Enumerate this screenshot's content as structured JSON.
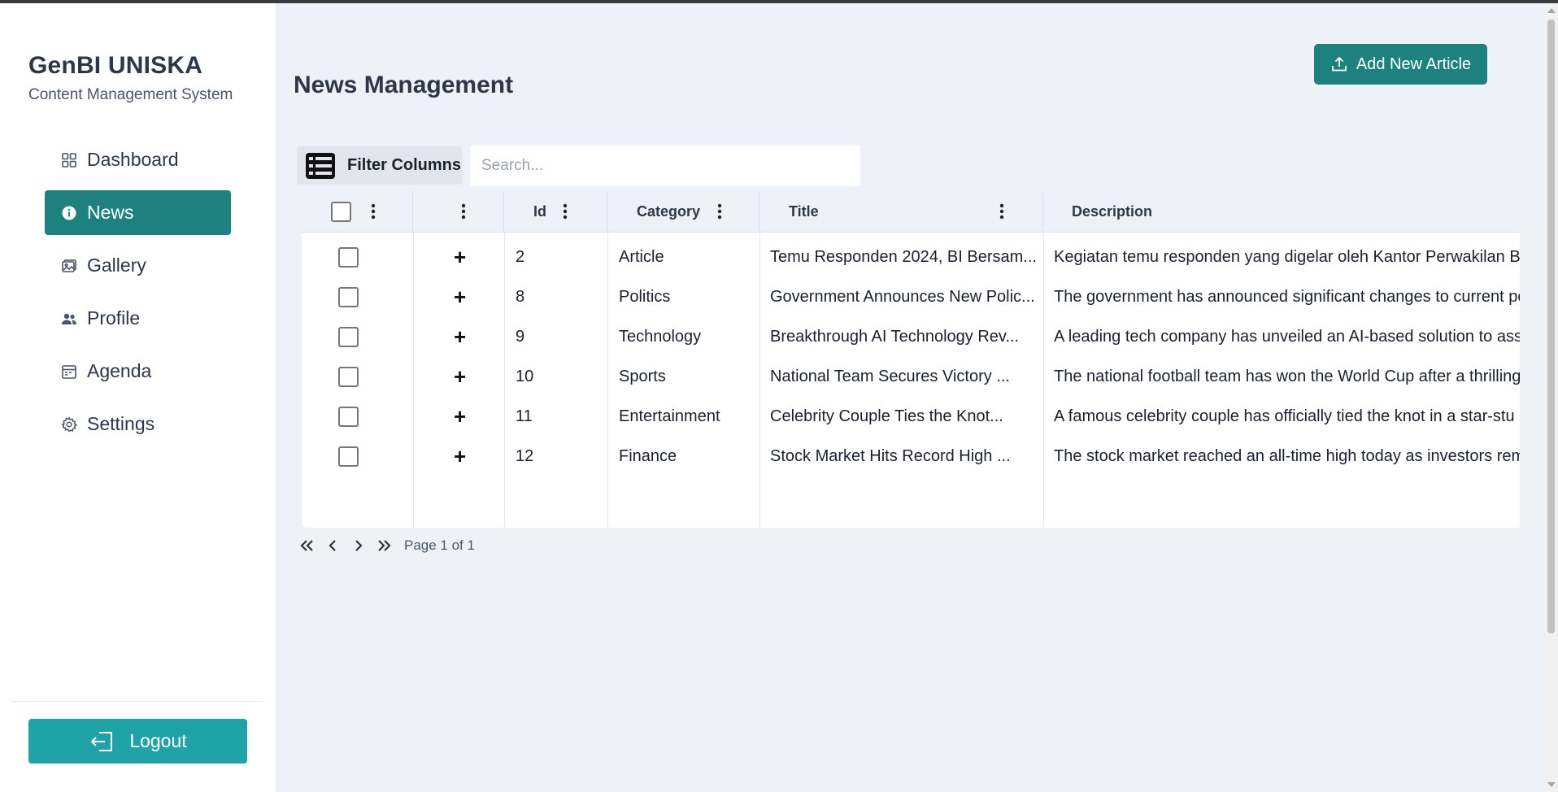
{
  "sidebar": {
    "brand_title": "GenBI UNISKA",
    "brand_subtitle": "Content Management System",
    "items": [
      {
        "label": "Dashboard",
        "icon": "grid-icon",
        "active": false
      },
      {
        "label": "News",
        "icon": "info-icon",
        "active": true
      },
      {
        "label": "Gallery",
        "icon": "image-icon",
        "active": false
      },
      {
        "label": "Profile",
        "icon": "users-icon",
        "active": false
      },
      {
        "label": "Agenda",
        "icon": "calendar-icon",
        "active": false
      },
      {
        "label": "Settings",
        "icon": "gear-icon",
        "active": false
      }
    ],
    "logout_label": "Logout"
  },
  "main": {
    "page_title": "News Management",
    "add_button_label": "Add New Article",
    "filter_button_label": "Filter Columns",
    "search_placeholder": "Search...",
    "search_value": ""
  },
  "table": {
    "headers": {
      "id": "Id",
      "category": "Category",
      "title": "Title",
      "description": "Description"
    },
    "rows": [
      {
        "id": "2",
        "category": "Article",
        "title": "Temu Responden 2024, BI Bersam...",
        "description": "Kegiatan temu responden yang digelar oleh Kantor Perwakilan Ba"
      },
      {
        "id": "8",
        "category": "Politics",
        "title": "Government Announces New Polic...",
        "description": "The government has announced significant changes to current po"
      },
      {
        "id": "9",
        "category": "Technology",
        "title": "Breakthrough AI Technology Rev...",
        "description": "A leading tech company has unveiled an AI-based solution to ass"
      },
      {
        "id": "10",
        "category": "Sports",
        "title": "National Team Secures Victory ...",
        "description": "The national football team has won the World Cup after a thrilling"
      },
      {
        "id": "11",
        "category": "Entertainment",
        "title": "Celebrity Couple Ties the Knot...",
        "description": "A famous celebrity couple has officially tied the knot in a star-stu"
      },
      {
        "id": "12",
        "category": "Finance",
        "title": "Stock Market Hits Record High ...",
        "description": "The stock market reached an all-time high today as investors rem"
      }
    ],
    "expand_symbol": "+"
  },
  "pagination": {
    "text": "Page 1 of 1"
  },
  "colors": {
    "primary": "#1f8080",
    "logout": "#20a3a6",
    "background": "#eef2f8"
  }
}
